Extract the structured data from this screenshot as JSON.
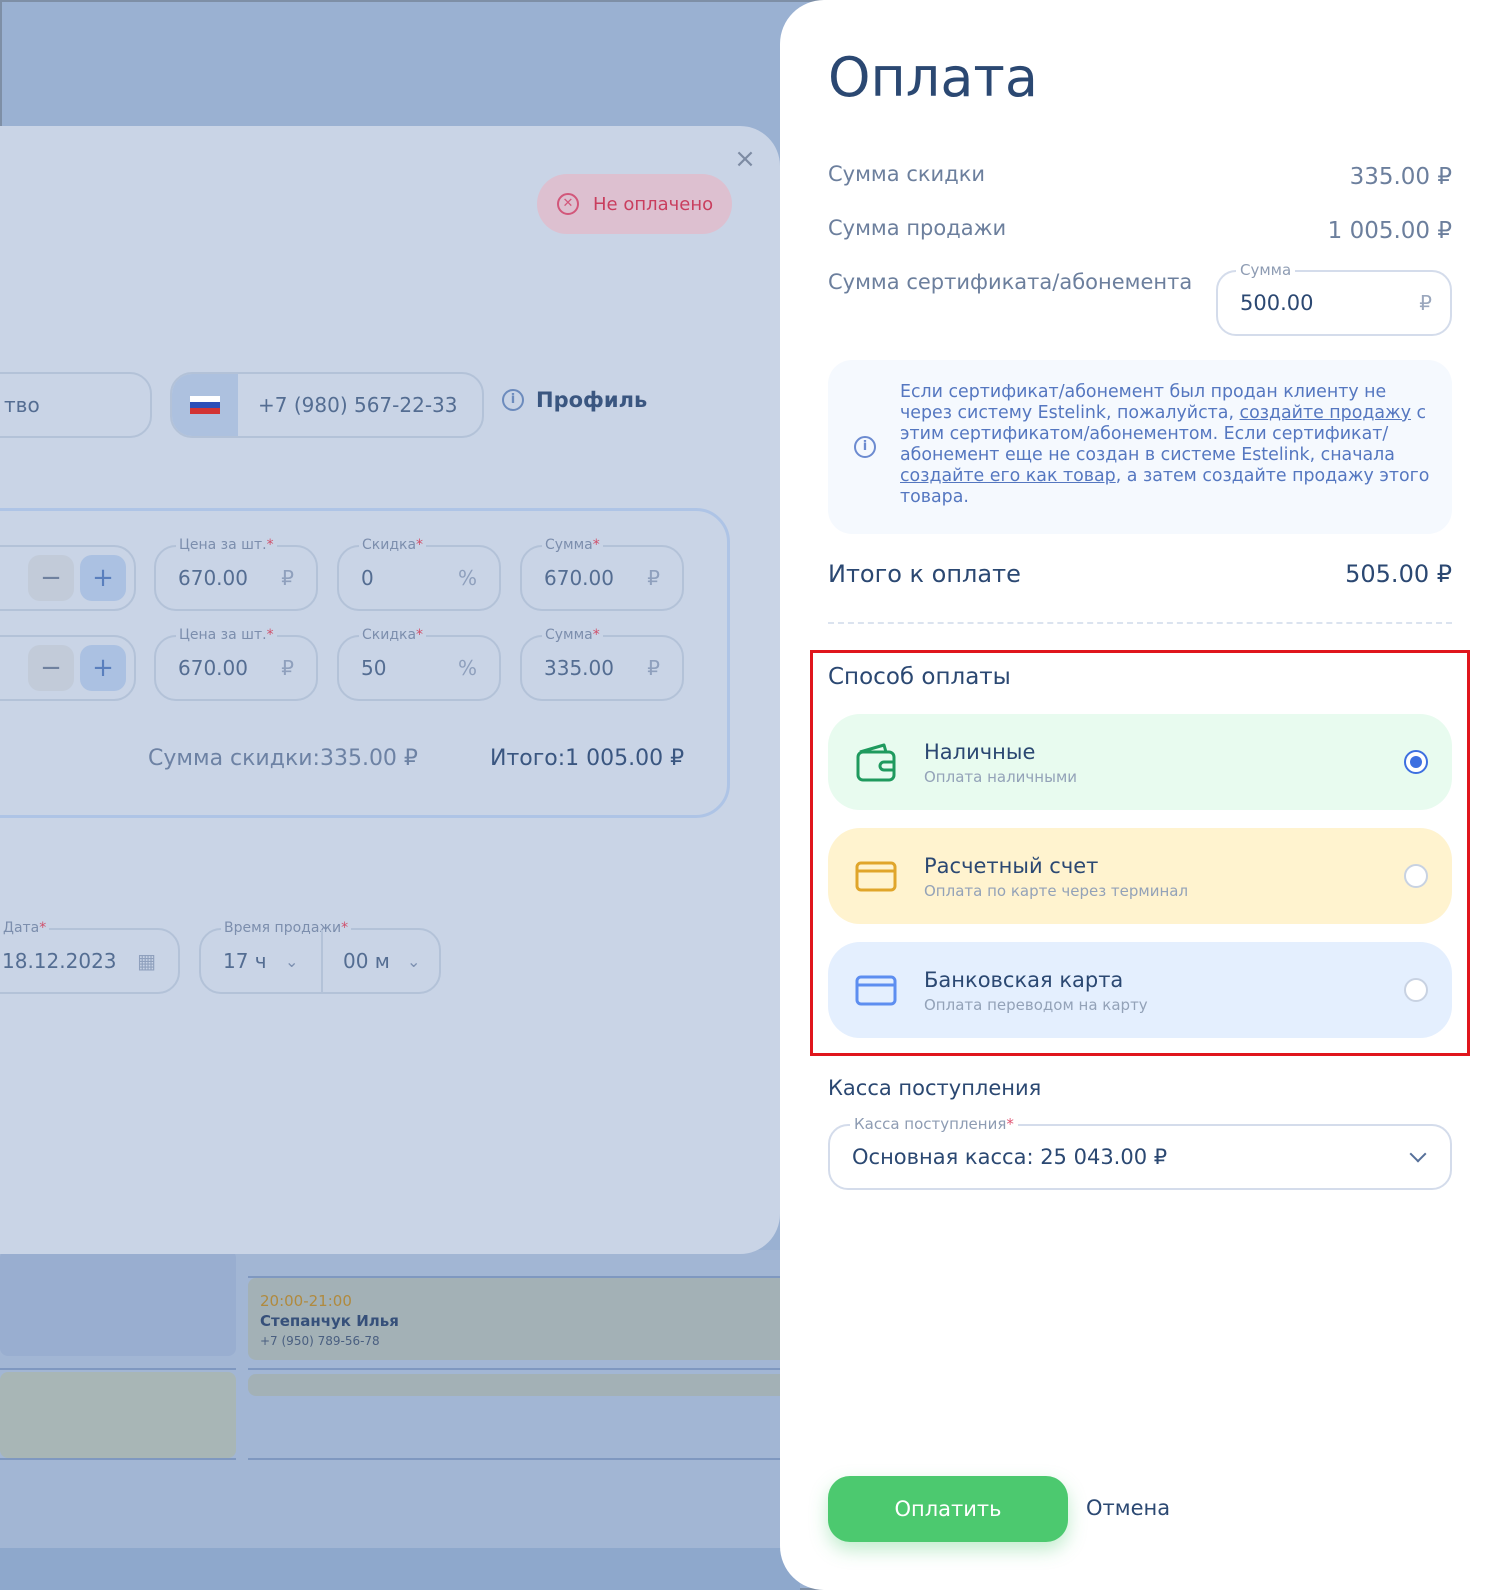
{
  "sale_modal": {
    "badge": "Не оплачено",
    "client_field_partial": "тво",
    "phone": "+7 (980) 567-22-33",
    "profile_link": "Профиль",
    "rows": [
      {
        "price_label": "Цена за шт.",
        "price": "670.00",
        "discount_label": "Скидка",
        "discount": "0",
        "sum_label": "Сумма",
        "sum": "670.00"
      },
      {
        "price_label": "Цена за шт.",
        "price": "670.00",
        "discount_label": "Скидка",
        "discount": "50",
        "sum_label": "Сумма",
        "sum": "335.00"
      }
    ],
    "currency": "₽",
    "percent": "%",
    "discount_total_label": "Сумма скидки:",
    "discount_total_value": "335.00 ₽",
    "total_label": "Итого:",
    "total_value": "1 005.00 ₽",
    "date_label": "Дата",
    "date_value": "18.12.2023",
    "time_label": "Время продажи",
    "hour_value": "17 ч",
    "minute_value": "00 м"
  },
  "background_event": {
    "time": "20:00-21:00",
    "name": "Степанчук Илья",
    "phone": "+7 (950) 789-56-78"
  },
  "payment": {
    "title": "Оплата",
    "discount_sum_label": "Сумма скидки",
    "discount_sum_value": "335.00 ₽",
    "sale_sum_label": "Сумма продажи",
    "sale_sum_value": "1 005.00 ₽",
    "certificate_label": "Сумма сертификата/абонемента",
    "certificate_field_legend": "Сумма",
    "certificate_field_value": "500.00",
    "certificate_field_unit": "₽",
    "info": {
      "part1": "Если сертификат/абонемент был продан клиенту не через систему Estelink, пожалуйста, ",
      "link1": "создайте продажу",
      "part2": " с этим сертификатом/абонементом. Если сертификат/абонемент еще не создан в системе Estelink, сначала ",
      "link2": "создайте его как товар",
      "part3": ", а затем создайте продажу этого товара."
    },
    "total_label": "Итого к оплате",
    "total_value": "505.00 ₽",
    "method_title": "Способ оплаты",
    "methods": [
      {
        "name": "Наличные",
        "sub": "Оплата наличными",
        "selected": true,
        "bg": "#e8fbef",
        "icon": "wallet-icon",
        "color": "#1f9a5e"
      },
      {
        "name": "Расчетный счет",
        "sub": "Оплата по карте через терминал",
        "selected": false,
        "bg": "#fff3cf",
        "icon": "card-icon",
        "color": "#e0a52a"
      },
      {
        "name": "Банковская карта",
        "sub": "Оплата переводом на карту",
        "selected": false,
        "bg": "#e4effe",
        "icon": "card-icon",
        "color": "#5d8ef0"
      }
    ],
    "cash_title": "Касса поступления",
    "cash_field_legend": "Касса поступления",
    "cash_field_value": "Основная касса: 25 043.00 ₽",
    "pay_button": "Оплатить",
    "cancel_button": "Отмена"
  }
}
